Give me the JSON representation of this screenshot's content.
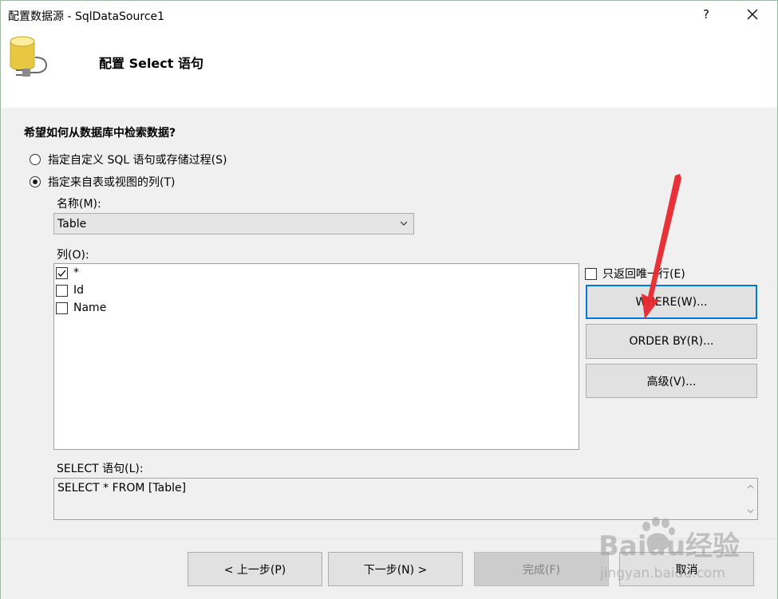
{
  "window": {
    "title": "配置数据源 - SqlDataSource1",
    "help_label": "?"
  },
  "header": {
    "title": "配置 Select 语句"
  },
  "form": {
    "question": "希望如何从数据库中检索数据?",
    "option_custom": "指定自定义 SQL 语句或存储过程(S)",
    "option_table": "指定来自表或视图的列(T)",
    "selected_option": "option_table",
    "name_label": "名称(M):",
    "name_value": "Table",
    "columns_label": "列(O):",
    "columns": [
      {
        "label": "*",
        "checked": true
      },
      {
        "label": "Id",
        "checked": false
      },
      {
        "label": "Name",
        "checked": false
      }
    ],
    "unique_rows_label": "只返回唯一行(E)",
    "unique_rows_checked": false,
    "where_button": "WHERE(W)...",
    "orderby_button": "ORDER BY(R)...",
    "advanced_button": "高级(V)...",
    "sql_label": "SELECT 语句(L):",
    "sql_value": "SELECT * FROM [Table]"
  },
  "footer": {
    "back_button": "< 上一步(P)",
    "next_button": "下一步(N) >",
    "finish_button": "完成(F)",
    "cancel_button": "取消"
  },
  "watermark": {
    "brand": "Baidu经验",
    "url": "jingyan.baidu.com"
  },
  "colors": {
    "accent": "#0078d7",
    "annotation_arrow": "#e8262d",
    "panel_bg": "#f0f0f0"
  }
}
